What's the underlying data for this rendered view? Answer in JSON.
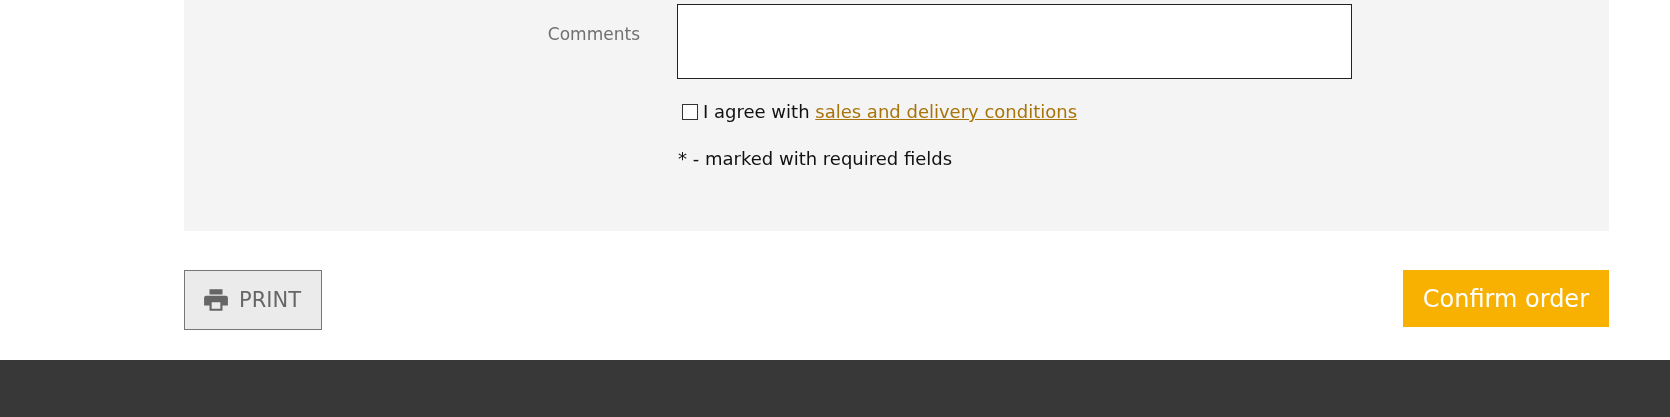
{
  "form": {
    "comments_label": "Comments",
    "agree": {
      "checked": false,
      "text": "I agree with ",
      "link": "sales and delivery conditions"
    },
    "required_note": "* - marked with required fields"
  },
  "actions": {
    "print": "PRINT",
    "confirm": "Confirm order"
  }
}
